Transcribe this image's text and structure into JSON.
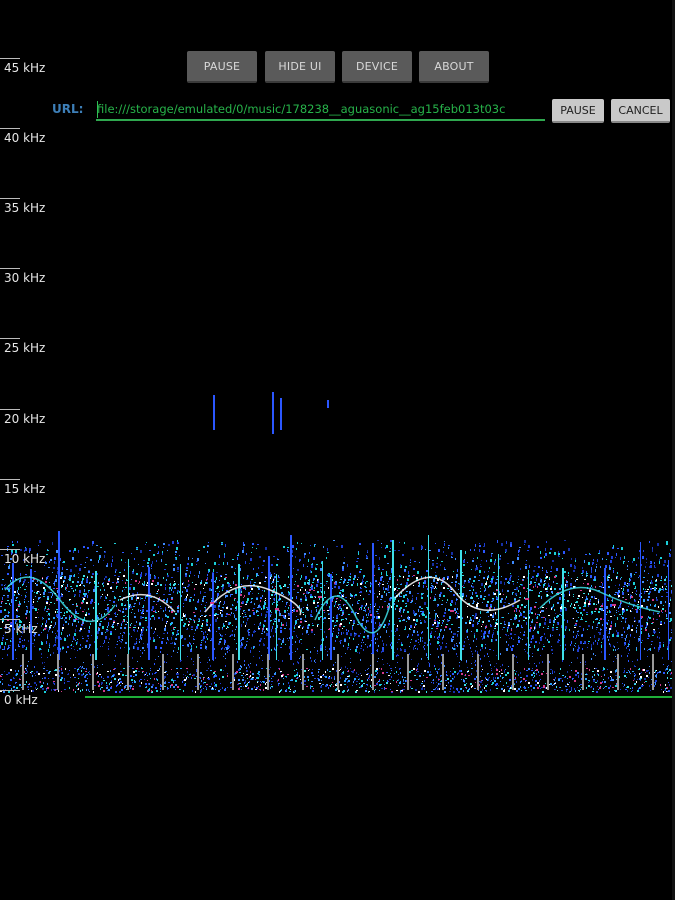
{
  "toolbar": {
    "pause_label": "PAUSE",
    "hide_ui_label": "HIDE UI",
    "device_label": "DEVICE",
    "about_label": "ABOUT"
  },
  "url_bar": {
    "label": "URL:",
    "value": "file:///storage/emulated/0/music/178238__aguasonic__ag15feb013t03c",
    "pause_label": "PAUSE",
    "cancel_label": "CANCEL"
  },
  "frequency_axis": {
    "labels": [
      "45 kHz",
      "40 kHz",
      "35 kHz",
      "30 kHz",
      "25 kHz",
      "20 kHz",
      "15 kHz",
      "10 kHz",
      "5 kHz",
      "0 kHz"
    ]
  },
  "colors": {
    "background": "#000000",
    "url_text": "#27b34a",
    "url_label": "#3d7fb8",
    "baseline": "#1fae3a"
  }
}
